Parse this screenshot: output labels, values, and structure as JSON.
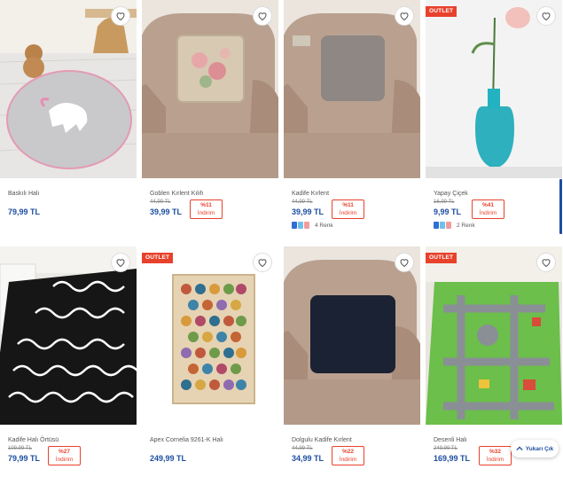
{
  "products": [
    {
      "name": "Baskılı Halı",
      "price": "79,99 TL",
      "old_price": "",
      "discount_pct": "",
      "discount_label": "",
      "outlet": "",
      "colors_label": ""
    },
    {
      "name": "Goblen Kırlent Kılıfı",
      "price": "39,99 TL",
      "old_price": "44,99 TL",
      "discount_pct": "%11",
      "discount_label": "İndirim",
      "outlet": "",
      "colors_label": ""
    },
    {
      "name": "Kadife Kırlent",
      "price": "39,99 TL",
      "old_price": "44,99 TL",
      "discount_pct": "%11",
      "discount_label": "İndirim",
      "outlet": "",
      "colors_label": "4 Renk"
    },
    {
      "name": "Yapay Çiçek",
      "price": "9,99 TL",
      "old_price": "16,99 TL",
      "discount_pct": "%41",
      "discount_label": "İndirim",
      "outlet": "OUTLET",
      "colors_label": "2 Renk"
    },
    {
      "name": "Kadife Halı Örtüsü",
      "price": "79,99 TL",
      "old_price": "109,99 TL",
      "discount_pct": "%27",
      "discount_label": "İndirim",
      "outlet": "",
      "colors_label": ""
    },
    {
      "name": "Apex Cornelia 9261-K Halı",
      "price": "249,99 TL",
      "old_price": "",
      "discount_pct": "",
      "discount_label": "",
      "outlet": "OUTLET",
      "colors_label": ""
    },
    {
      "name": "Dolgulu Kadife Kırlent",
      "price": "34,99 TL",
      "old_price": "44,99 TL",
      "discount_pct": "%22",
      "discount_label": "İndirim",
      "outlet": "",
      "colors_label": ""
    },
    {
      "name": "Desenli Halı",
      "price": "169,99 TL",
      "old_price": "249,99 TL",
      "discount_pct": "%32",
      "discount_label": "İndirim",
      "outlet": "OUTLET",
      "colors_label": ""
    }
  ],
  "scroll_top": {
    "label": "Yukarı Çık"
  },
  "colors": {
    "price": "#1d4ea0",
    "discount": "#e8412c",
    "outlet_badge": "#e8412c"
  },
  "icons": {
    "favorite": "heart-outline-icon",
    "scroll_up": "chevron-up-icon"
  }
}
